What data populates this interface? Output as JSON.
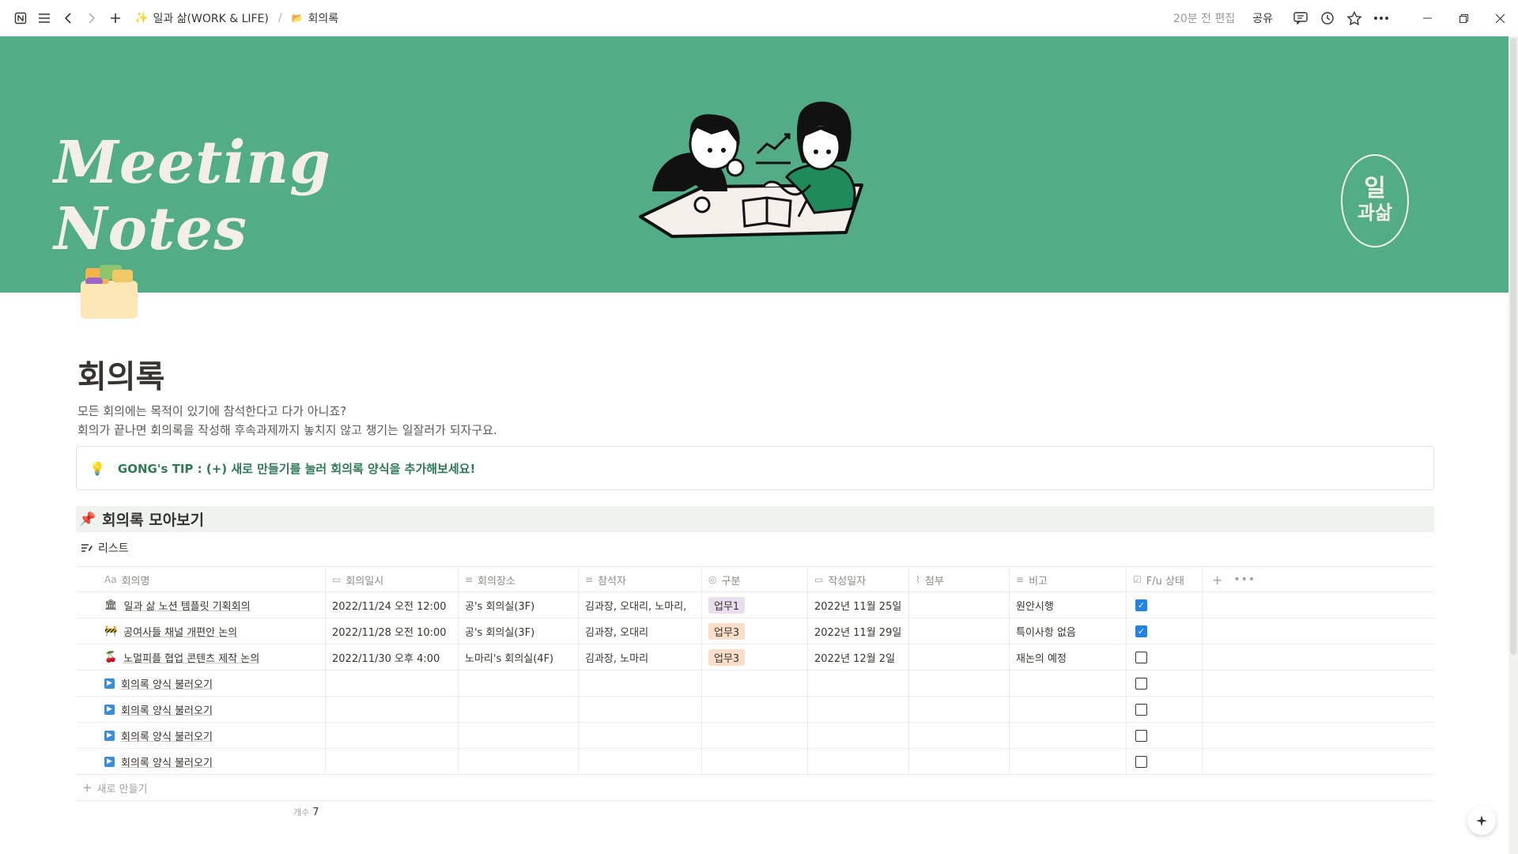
{
  "topbar": {
    "breadcrumb": [
      {
        "label": "일과 삶(WORK & LIFE)",
        "icon": "sparkle-icon"
      },
      {
        "label": "회의록",
        "icon": "folder-icon"
      }
    ],
    "edited": "20분 전 편집",
    "share": "공유"
  },
  "cover": {
    "title_line1": "Meeting",
    "title_line2": "Notes",
    "logo_top": "일",
    "logo_bottom": "과삶"
  },
  "page": {
    "title": "회의록",
    "desc_line1": "모든 회의에는 목적이 있기에 참석한다고 다가 아니죠?",
    "desc_line2": "회의가 끝나면 회의록을 작성해 후속과제까지 놓치지 않고 챙기는 일잘러가 되자구요.",
    "callout": "GONG's TIP : (+) 새로 만들기를 눌러 회의록 양식을 추가해보세요!",
    "section_heading": "회의록 모아보기",
    "view_tab": "리스트"
  },
  "table": {
    "columns": [
      {
        "label": "회의명",
        "icon": "Aa"
      },
      {
        "label": "회의일시",
        "icon": "calendar-icon"
      },
      {
        "label": "회의장소",
        "icon": "text-icon"
      },
      {
        "label": "참석자",
        "icon": "text-icon"
      },
      {
        "label": "구분",
        "icon": "select-icon"
      },
      {
        "label": "작성일자",
        "icon": "calendar-icon"
      },
      {
        "label": "첨부",
        "icon": "paperclip-icon"
      },
      {
        "label": "비고",
        "icon": "text-icon"
      },
      {
        "label": "F/u 상태",
        "icon": "checkbox-icon"
      }
    ],
    "rows": [
      {
        "icon": "🏛",
        "title": "일과 삶 노션 템플릿 기획회의",
        "datetime": "2022/11/24 오전 12:00",
        "place": "공's 회의실(3F)",
        "attendees": "김과장, 오대리, 노마리,",
        "type": "업무1",
        "type_color": "#e8deee",
        "created": "2022년 11월 25일",
        "attach": "",
        "note": "원안시행",
        "done": true
      },
      {
        "icon": "🚧",
        "title": "공여사들 채널 개편안 논의",
        "datetime": "2022/11/28 오전 10:00",
        "place": "공's 회의실(3F)",
        "attendees": "김과장, 오대리",
        "type": "업무3",
        "type_color": "#fadec9",
        "created": "2022년 11월 29일",
        "attach": "",
        "note": "특이사항 없음",
        "done": true
      },
      {
        "icon": "🍒",
        "title": "노멀피플 협업 콘텐츠 제작 논의",
        "datetime": "2022/11/30 오후 4:00",
        "place": "노마리's 회의실(4F)",
        "attendees": "김과장, 노마리",
        "type": "업무3",
        "type_color": "#fadec9",
        "created": "2022년 12월 2일",
        "attach": "",
        "note": "재논의 예정",
        "done": false
      },
      {
        "icon": "➡",
        "title": "회의록 양식 불러오기",
        "datetime": "",
        "place": "",
        "attendees": "",
        "type": "",
        "type_color": "",
        "created": "",
        "attach": "",
        "note": "",
        "done": false
      },
      {
        "icon": "➡",
        "title": "회의록 양식 불러오기",
        "datetime": "",
        "place": "",
        "attendees": "",
        "type": "",
        "type_color": "",
        "created": "",
        "attach": "",
        "note": "",
        "done": false
      },
      {
        "icon": "➡",
        "title": "회의록 양식 불러오기",
        "datetime": "",
        "place": "",
        "attendees": "",
        "type": "",
        "type_color": "",
        "created": "",
        "attach": "",
        "note": "",
        "done": false
      },
      {
        "icon": "➡",
        "title": "회의록 양식 불러오기",
        "datetime": "",
        "place": "",
        "attendees": "",
        "type": "",
        "type_color": "",
        "created": "",
        "attach": "",
        "note": "",
        "done": false
      }
    ],
    "new_label": "새로 만들기",
    "count_label": "개수",
    "count_value": "7"
  },
  "colors": {
    "cover_bg": "#52ad86",
    "callout_text": "#2f7a57",
    "heading_bg": "#eef3ed",
    "checkbox_on": "#2383e2"
  }
}
